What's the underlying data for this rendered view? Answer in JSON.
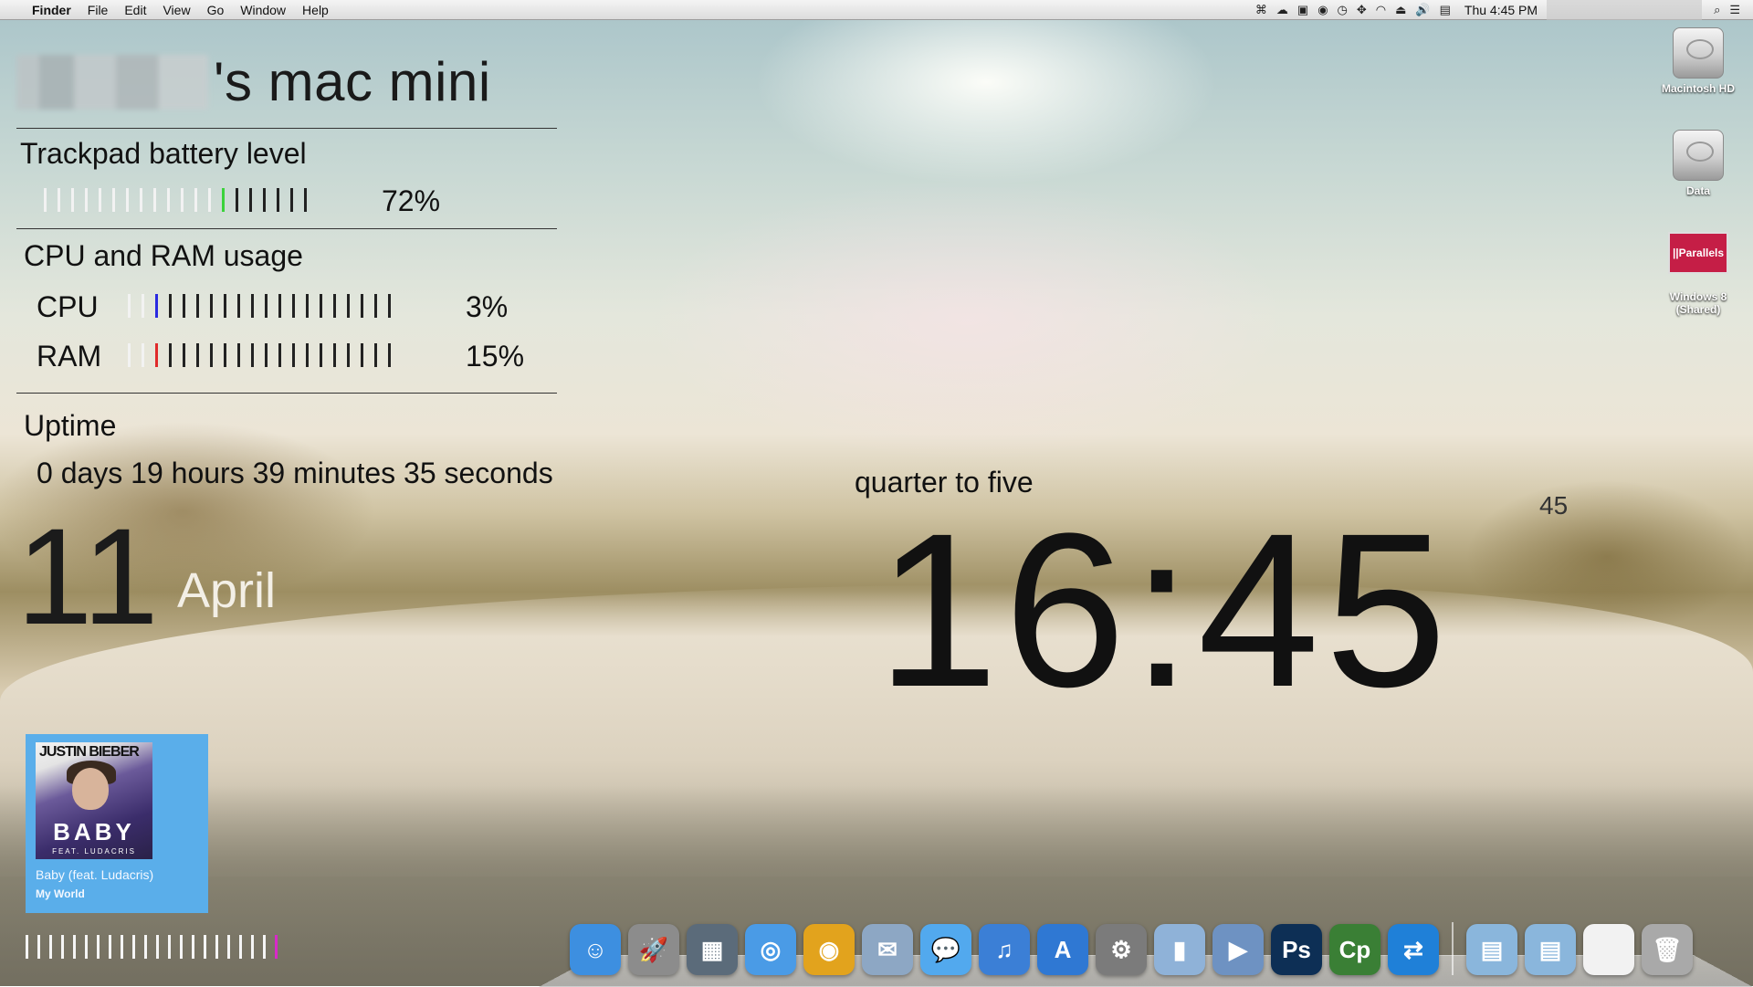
{
  "menubar": {
    "apple": "",
    "items": [
      "Finder",
      "File",
      "Edit",
      "View",
      "Go",
      "Window",
      "Help"
    ],
    "status_icons": [
      "gamepad-icon",
      "cloud-icon",
      "window-icon",
      "chrome-icon",
      "time-machine-icon",
      "move-icon",
      "wifi-icon",
      "eject-icon",
      "volume-icon",
      "flag-icon"
    ],
    "clock": "Thu 4:45 PM"
  },
  "widgets": {
    "host_suffix": "'s mac mini",
    "battery": {
      "title": "Trackpad battery level",
      "level": 0.72,
      "percent": "72%",
      "accent": "#3bd23b"
    },
    "usage": {
      "title": "CPU and RAM usage",
      "cpu": {
        "label": "CPU",
        "percent": "3%",
        "accent": "#2a2ae0"
      },
      "ram": {
        "label": "RAM",
        "percent": "15%",
        "accent": "#e02a2a"
      }
    },
    "uptime": {
      "title": "Uptime",
      "value": "0 days 19 hours 39 minutes 35 seconds"
    },
    "date": {
      "day": "11",
      "month": "April"
    },
    "clock": {
      "words": "quarter to five",
      "time": "16:45",
      "seconds": "45"
    }
  },
  "now_playing": {
    "artist_art": "JUSTIN BIEBER",
    "album_art": "BABY",
    "feat_art": "FEAT. LUDACRIS",
    "track": "Baby (feat. Ludacris)",
    "album": "My World",
    "progress_accent": "#d829c8"
  },
  "desktop_icons": [
    {
      "label": "Macintosh HD"
    },
    {
      "label": "Data"
    },
    {
      "label": "Windows 8 (Shared)",
      "badge": "||Parallels"
    }
  ],
  "dock": {
    "apps": [
      {
        "name": "finder-icon",
        "color": "#3d8fe0",
        "glyph": "☺"
      },
      {
        "name": "launchpad-icon",
        "color": "#8c8c8c",
        "glyph": "🚀"
      },
      {
        "name": "photo-icon",
        "color": "#5b6b7a",
        "glyph": "▦"
      },
      {
        "name": "safari-icon",
        "color": "#4a9be6",
        "glyph": "◎"
      },
      {
        "name": "chrome-icon",
        "color": "#e2a31d",
        "glyph": "◉"
      },
      {
        "name": "mail-icon",
        "color": "#8da7c4",
        "glyph": "✉"
      },
      {
        "name": "messages-icon",
        "color": "#52a9ee",
        "glyph": "💬"
      },
      {
        "name": "itunes-icon",
        "color": "#3b7fd6",
        "glyph": "♫"
      },
      {
        "name": "app-store-icon",
        "color": "#2f78d3",
        "glyph": "A"
      },
      {
        "name": "system-preferences-icon",
        "color": "#7b7b7b",
        "glyph": "⚙"
      },
      {
        "name": "parallels-icon",
        "color": "#8fb2d8",
        "glyph": "▮"
      },
      {
        "name": "preview-icon",
        "color": "#6e92c2",
        "glyph": "▶"
      },
      {
        "name": "photoshop-icon",
        "color": "#0d2f55",
        "glyph": "Ps"
      },
      {
        "name": "captivate-icon",
        "color": "#3a7f35",
        "glyph": "Cp"
      },
      {
        "name": "teamviewer-icon",
        "color": "#1f80d8",
        "glyph": "⇄"
      }
    ],
    "right": [
      {
        "name": "downloads-folder-icon",
        "color": "#8ab6dc",
        "glyph": "▤"
      },
      {
        "name": "applications-folder-icon",
        "color": "#8ab6dc",
        "glyph": "▤"
      },
      {
        "name": "document-icon",
        "color": "#f2f2f2",
        "glyph": ""
      },
      {
        "name": "trash-icon",
        "color": "#a9a9a9",
        "glyph": "🗑"
      }
    ]
  }
}
